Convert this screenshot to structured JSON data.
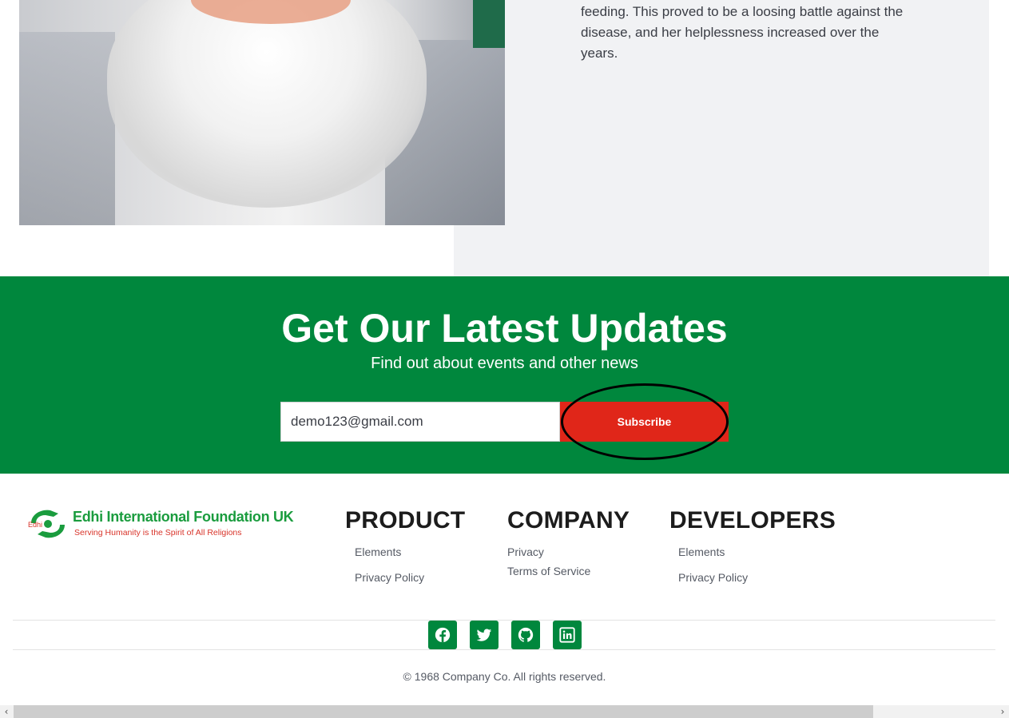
{
  "bio": {
    "text": "feeding. This proved to be a loosing battle against the disease, and her helplessness increased over the years."
  },
  "newsletter": {
    "title": "Get Our Latest Updates",
    "subtitle": "Find out about events and other news",
    "email_value": "demo123@gmail.com",
    "subscribe_label": "Subscribe",
    "accent_color": "#00873d",
    "button_color": "#e02619"
  },
  "logo": {
    "name": "Edhi International Foundation UK",
    "tagline": "Serving Humanity is the Spirit of All Religions"
  },
  "footer": {
    "columns": [
      {
        "heading": "PRODUCT",
        "links": [
          "Elements",
          "Privacy Policy"
        ]
      },
      {
        "heading": "COMPANY",
        "links": [
          "Privacy",
          "Terms of Service"
        ]
      },
      {
        "heading": "DEVELOPERS",
        "links": [
          "Elements",
          "Privacy Policy"
        ]
      }
    ],
    "socials": [
      "facebook-icon",
      "twitter-icon",
      "github-icon",
      "linkedin-icon"
    ],
    "copyright": "© 1968 Company Co. All rights reserved."
  }
}
